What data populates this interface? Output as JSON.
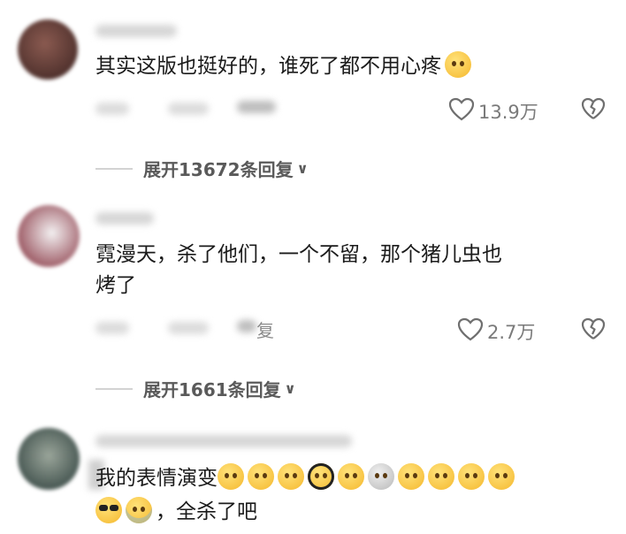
{
  "comments": [
    {
      "text": "其实这版也挺好的，谁死了都不用心疼",
      "likes": "13.9万",
      "expand_label": "展开13672条回复"
    },
    {
      "text_line1": "霓漫天，杀了他们，一个不留，那个猪儿虫也",
      "text_line2": "烤了",
      "reply_tail": "复",
      "likes": "2.7万",
      "expand_label": "展开1661条回复"
    },
    {
      "text_line1_prefix": "我的表情演变",
      "text_line2_suffix": "，全杀了吧",
      "emojis_line1": [
        "smiling-face",
        "smirk-face",
        "flushed-face",
        "headphones-face",
        "exploding-face",
        "screaming-face",
        "pleading-face",
        "grin-sweat-face",
        "pleading-face-2",
        "cover-mouth-face"
      ],
      "emojis_line2": [
        "cool-face",
        "crying-face"
      ]
    }
  ],
  "colors": {
    "heart": "#6f6f6f",
    "text": "#1b1b1b",
    "muted": "#7a7a7a"
  }
}
